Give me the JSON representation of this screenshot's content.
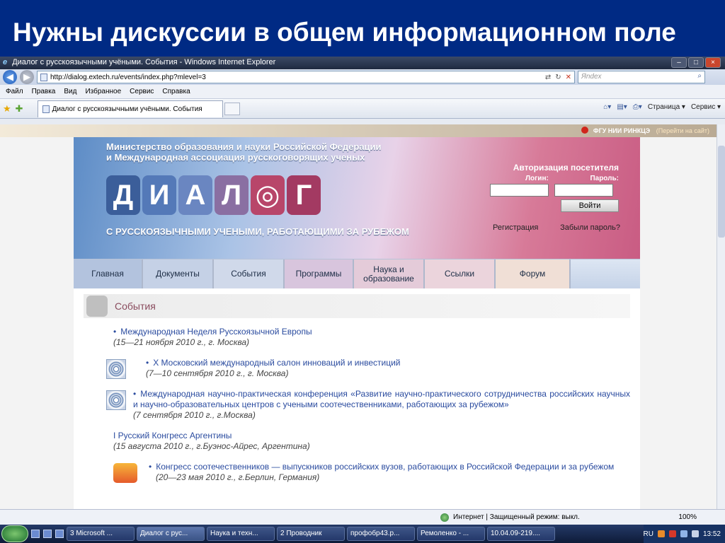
{
  "slide": {
    "title": "Нужны дискуссии в общем информационном поле"
  },
  "window": {
    "title": "Диалог с русскоязычными учёными. События - Windows Internet Explorer"
  },
  "address": {
    "url": "http://dialog.extech.ru/events/index.php?mlevel=3",
    "search_placeholder": "Яndex"
  },
  "menubar": [
    "Файл",
    "Правка",
    "Вид",
    "Избранное",
    "Сервис",
    "Справка"
  ],
  "tab": {
    "title": "Диалог с русскоязычными учёными. События"
  },
  "toolbar": {
    "page_label": "Страница ▾",
    "tools_label": "Сервис ▾"
  },
  "sitebar": {
    "org": "ФГУ НИИ РИНКЦЭ",
    "link": "(Перейти на сайт)"
  },
  "site": {
    "ministry_line1": "Министерство образования и науки Российской Федерации",
    "ministry_line2": "и Международная ассоциация русскоговорящих ученых",
    "logo_letters": [
      "Д",
      "И",
      "А",
      "Л",
      "◎",
      "Г"
    ],
    "tagline": "С РУССКОЯЗЫЧНЫМИ УЧЕНЫМИ, РАБОТАЮЩИМИ ЗА РУБЕЖОМ",
    "auth": {
      "title": "Авторизация посетителя",
      "login_label": "Логин:",
      "password_label": "Пароль:",
      "button": "Войти",
      "register": "Регистрация",
      "forgot": "Забыли пароль?"
    },
    "menu": [
      "Главная",
      "Документы",
      "События",
      "Программы",
      "Наука и образование",
      "Ссылки",
      "Форум"
    ],
    "section_title": "События",
    "events": [
      {
        "title": "Международная Неделя Русскоязычной Европы",
        "when": "15—21 ноября 2010 г., г. Москва"
      },
      {
        "title": "X Московский международный салон инноваций и инвестиций",
        "when": "7—10 сентября 2010 г., г. Москва"
      },
      {
        "title": "Международная научно-практическая конференция «Развитие научно-практического сотрудничества российских научных и научно-образовательных центров с учеными соотечественниками, работающих за рубежом»",
        "when": "7 сентября 2010 г., г.Москва"
      },
      {
        "title": "I Русский Конгресс Аргентины",
        "when": "15 августа 2010 г., г.Буэнос-Айрес, Аргентина"
      },
      {
        "title": "Конгресс соотечественников — выпускников российских вузов, работающих в Российской Федерации и за рубежом",
        "when": "20—23 мая 2010 г., г.Берлин, Германия"
      }
    ]
  },
  "statusbar": {
    "zone": "Интернет | Защищенный режим: выкл.",
    "zoom": "100%"
  },
  "taskbar": {
    "tasks": [
      "3 Microsoft ...",
      "Диалог с рус...",
      "Наука и техн...",
      "2 Проводник",
      "профобр43.р...",
      "Ремоленко - ...",
      "10.04.09-219...."
    ],
    "lang": "RU",
    "time": "13:52"
  }
}
